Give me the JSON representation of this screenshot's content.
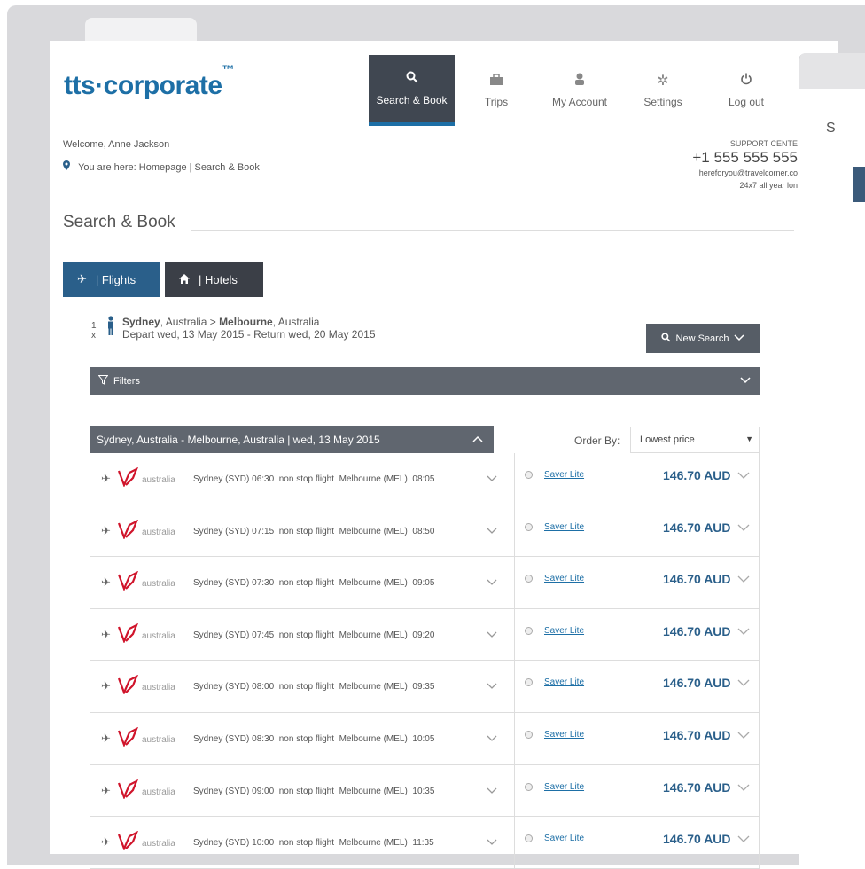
{
  "brand": {
    "name": "tts·corporate",
    "tm": "™"
  },
  "nav": [
    {
      "label": "Search & Book",
      "icon": "search-icon",
      "active": true
    },
    {
      "label": "Trips",
      "icon": "suitcase-icon"
    },
    {
      "label": "My Account",
      "icon": "user-icon"
    },
    {
      "label": "Settings",
      "icon": "gear-icon"
    },
    {
      "label": "Log out",
      "icon": "power-icon"
    }
  ],
  "welcome": "Welcome, Anne Jackson",
  "breadcrumb": "You are here: Homepage | Search & Book",
  "support": {
    "title": "SUPPORT CENTE",
    "phone": "+1 555 555 555",
    "email": "hereforyou@travelcorner.co",
    "hours": "24x7 all year lon"
  },
  "section_title": "Search & Book",
  "tabs": {
    "flights": "| Flights",
    "hotels": "| Hotels"
  },
  "search": {
    "pax": "1 x",
    "from_city": "Sydney",
    "from_rest": ", Australia > ",
    "to_city": "Melbourne",
    "to_rest": ", Australia",
    "dates": "Depart wed, 13 May 2015   -  Return wed, 20 May 2015",
    "new_search": "New Search"
  },
  "filters_label": "Filters",
  "results_header": "Sydney, Australia - Melbourne, Australia | wed, 13 May 2015",
  "order_by_label": "Order By:",
  "order_by_value": "Lowest price",
  "back_window": {
    "letter": "S"
  },
  "flights": [
    {
      "airline": "australia",
      "from": "Sydney (SYD)",
      "dep": "06:30",
      "type": "non stop flight",
      "to": "Melbourne (MEL)",
      "arr": "08:05",
      "fare": "Saver Lite",
      "price": "146.70 AUD"
    },
    {
      "airline": "australia",
      "from": "Sydney (SYD)",
      "dep": "07:15",
      "type": "non stop flight",
      "to": "Melbourne (MEL)",
      "arr": "08:50",
      "fare": "Saver Lite",
      "price": "146.70 AUD"
    },
    {
      "airline": "australia",
      "from": "Sydney (SYD)",
      "dep": "07:30",
      "type": "non stop flight",
      "to": "Melbourne (MEL)",
      "arr": "09:05",
      "fare": "Saver Lite",
      "price": "146.70 AUD"
    },
    {
      "airline": "australia",
      "from": "Sydney (SYD)",
      "dep": "07:45",
      "type": "non stop flight",
      "to": "Melbourne (MEL)",
      "arr": "09:20",
      "fare": "Saver Lite",
      "price": "146.70 AUD"
    },
    {
      "airline": "australia",
      "from": "Sydney (SYD)",
      "dep": "08:00",
      "type": "non stop flight",
      "to": "Melbourne (MEL)",
      "arr": "09:35",
      "fare": "Saver Lite",
      "price": "146.70 AUD"
    },
    {
      "airline": "australia",
      "from": "Sydney (SYD)",
      "dep": "08:30",
      "type": "non stop flight",
      "to": "Melbourne (MEL)",
      "arr": "10:05",
      "fare": "Saver Lite",
      "price": "146.70 AUD"
    },
    {
      "airline": "australia",
      "from": "Sydney (SYD)",
      "dep": "09:00",
      "type": "non stop flight",
      "to": "Melbourne (MEL)",
      "arr": "10:35",
      "fare": "Saver Lite",
      "price": "146.70 AUD"
    },
    {
      "airline": "australia",
      "from": "Sydney (SYD)",
      "dep": "10:00",
      "type": "non stop flight",
      "to": "Melbourne (MEL)",
      "arr": "11:35",
      "fare": "Saver Lite",
      "price": "146.70 AUD"
    }
  ]
}
